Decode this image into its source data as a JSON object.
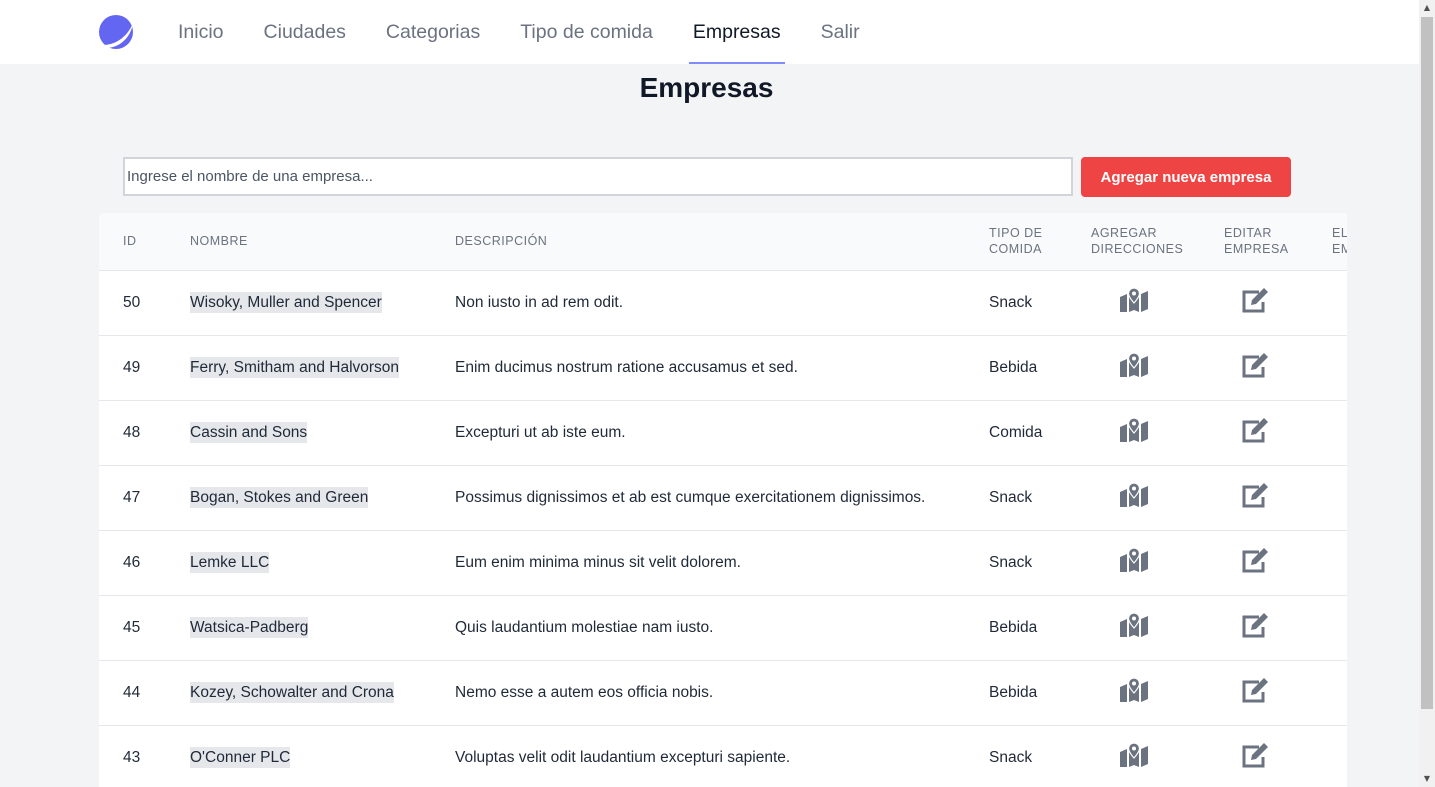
{
  "nav": {
    "items": [
      {
        "label": "Inicio",
        "active": false
      },
      {
        "label": "Ciudades",
        "active": false
      },
      {
        "label": "Categorias",
        "active": false
      },
      {
        "label": "Tipo de comida",
        "active": false
      },
      {
        "label": "Empresas",
        "active": true
      },
      {
        "label": "Salir",
        "active": false
      }
    ],
    "accent": "#818cf8"
  },
  "page": {
    "title": "Empresas"
  },
  "search": {
    "placeholder": "Ingrese el nombre de una empresa...",
    "value": ""
  },
  "actions": {
    "add_label": "Agregar nueva empresa",
    "add_color": "#ef4444"
  },
  "table": {
    "headers": {
      "id": "ID",
      "nombre": "NOMBRE",
      "descripcion": "DESCRIPCIÓN",
      "tipo_l1": "TIPO DE",
      "tipo_l2": "COMIDA",
      "dir_l1": "AGREGAR",
      "dir_l2": "DIRECCIONES",
      "edit_l1": "EDITAR",
      "edit_l2": "EMPRESA",
      "del_l1": "EL",
      "del_l2": "EM"
    },
    "rows": [
      {
        "id": "50",
        "nombre": "Wisoky, Muller and Spencer",
        "descripcion": "Non iusto in ad rem odit.",
        "tipo": "Snack"
      },
      {
        "id": "49",
        "nombre": "Ferry, Smitham and Halvorson",
        "descripcion": "Enim ducimus nostrum ratione accusamus et sed.",
        "tipo": "Bebida"
      },
      {
        "id": "48",
        "nombre": "Cassin and Sons",
        "descripcion": "Excepturi ut ab iste eum.",
        "tipo": "Comida"
      },
      {
        "id": "47",
        "nombre": "Bogan, Stokes and Green",
        "descripcion": "Possimus dignissimos et ab est cumque exercitationem dignissimos.",
        "tipo": "Snack"
      },
      {
        "id": "46",
        "nombre": "Lemke LLC",
        "descripcion": "Eum enim minima minus sit velit dolorem.",
        "tipo": "Snack"
      },
      {
        "id": "45",
        "nombre": "Watsica-Padberg",
        "descripcion": "Quis laudantium molestiae nam iusto.",
        "tipo": "Bebida"
      },
      {
        "id": "44",
        "nombre": "Kozey, Schowalter and Crona",
        "descripcion": "Nemo esse a autem eos officia nobis.",
        "tipo": "Bebida"
      },
      {
        "id": "43",
        "nombre": "O'Conner PLC",
        "descripcion": "Voluptas velit odit laudantium excepturi sapiente.",
        "tipo": "Snack"
      }
    ],
    "icons": {
      "add_address": "map-marker-icon",
      "edit": "edit-icon"
    },
    "icon_color": "#6b7280"
  }
}
